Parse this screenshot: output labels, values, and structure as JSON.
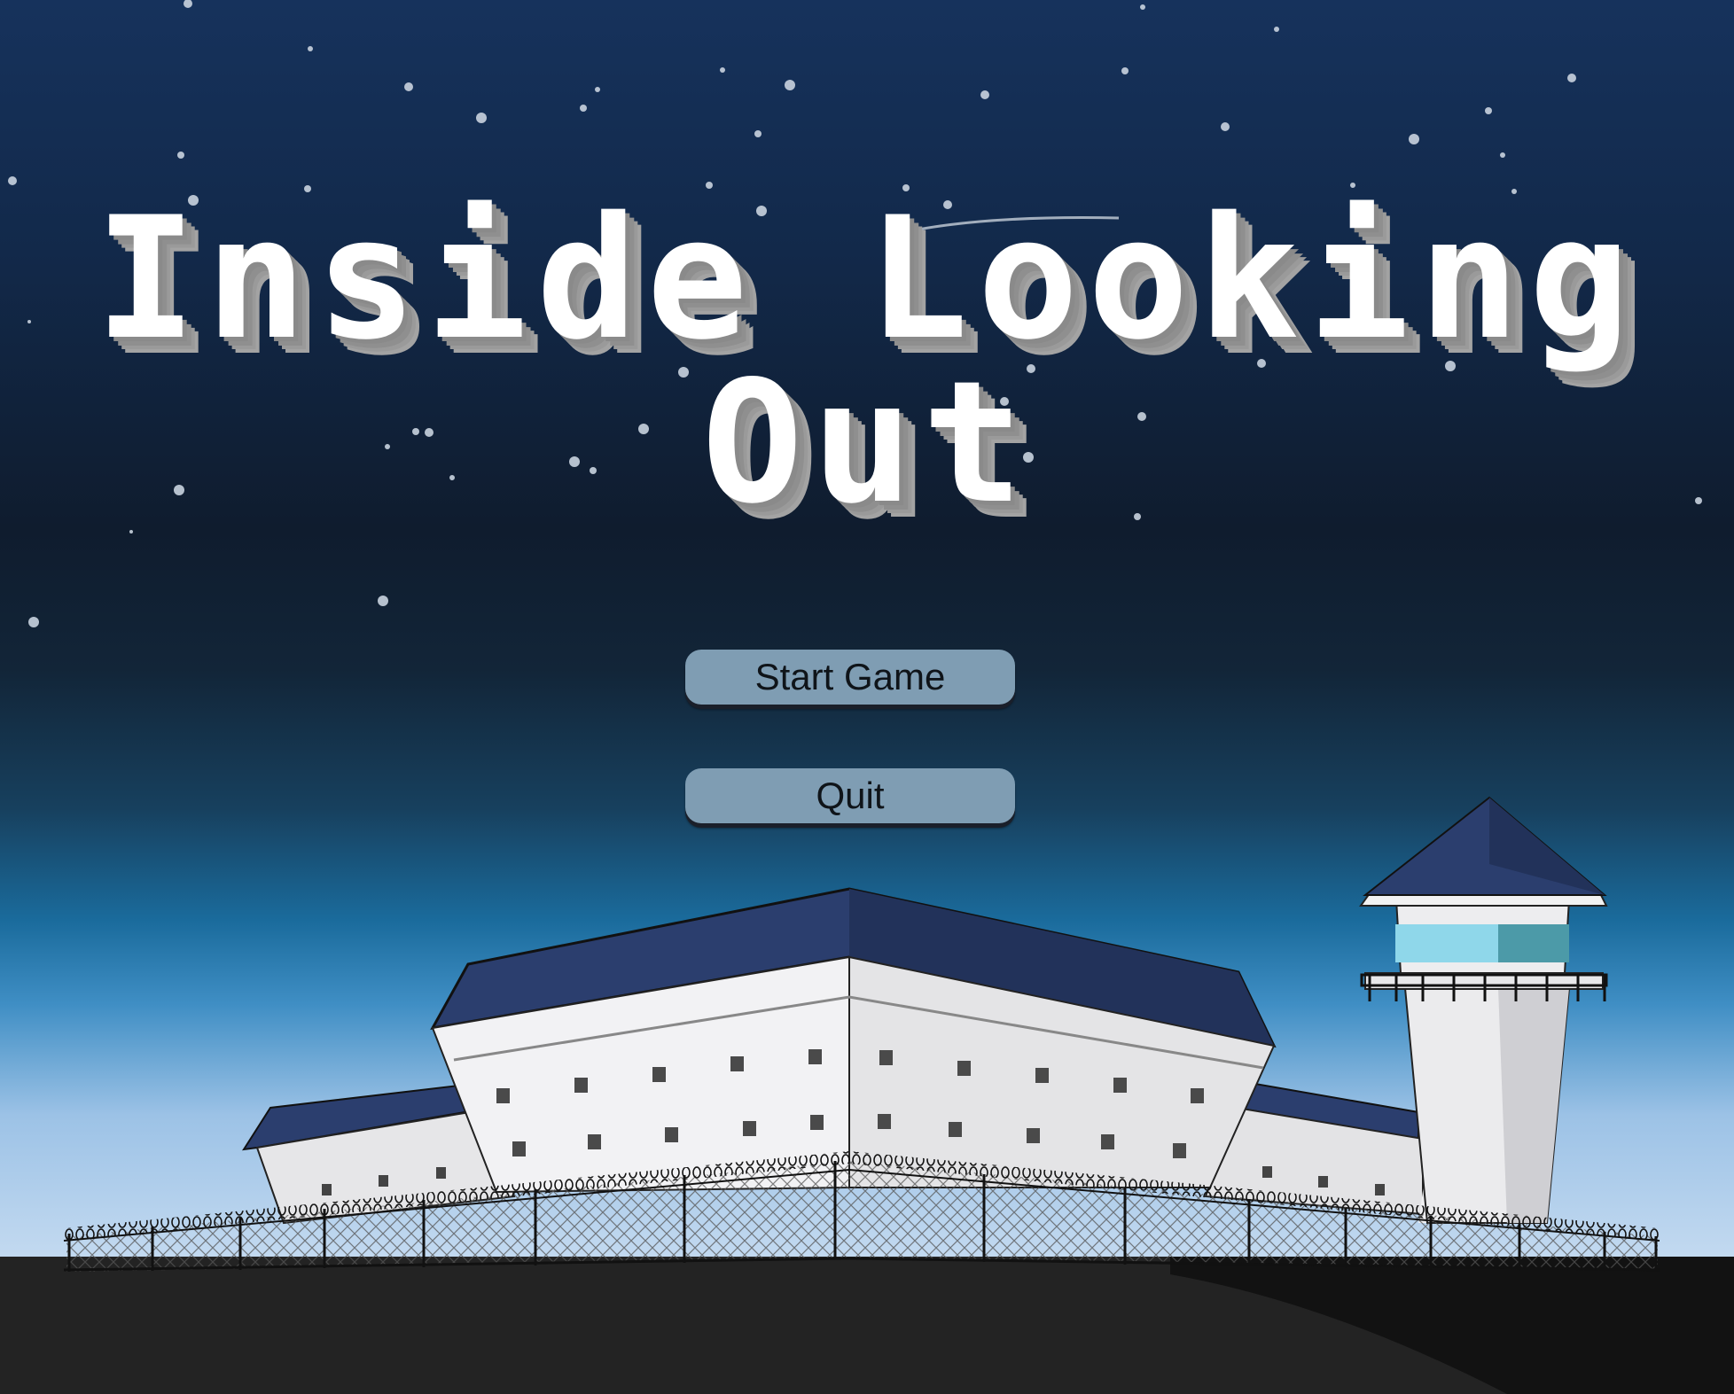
{
  "game": {
    "title_line1": "Inside Looking",
    "title_line2": "Out"
  },
  "menu": {
    "start_label": "Start Game",
    "quit_label": "Quit"
  },
  "colors": {
    "sky_top": "#16305a",
    "sky_mid": "#0f1d30",
    "sky_horizon": "#bcd3ec",
    "roof": "#2b3e6e",
    "wall": "#e8e8ea",
    "ground": "#222222",
    "button": "#7f9db3",
    "tower_glass": "#8ad4e8"
  },
  "icons": {
    "background": "night-sky-prison-illustration"
  }
}
